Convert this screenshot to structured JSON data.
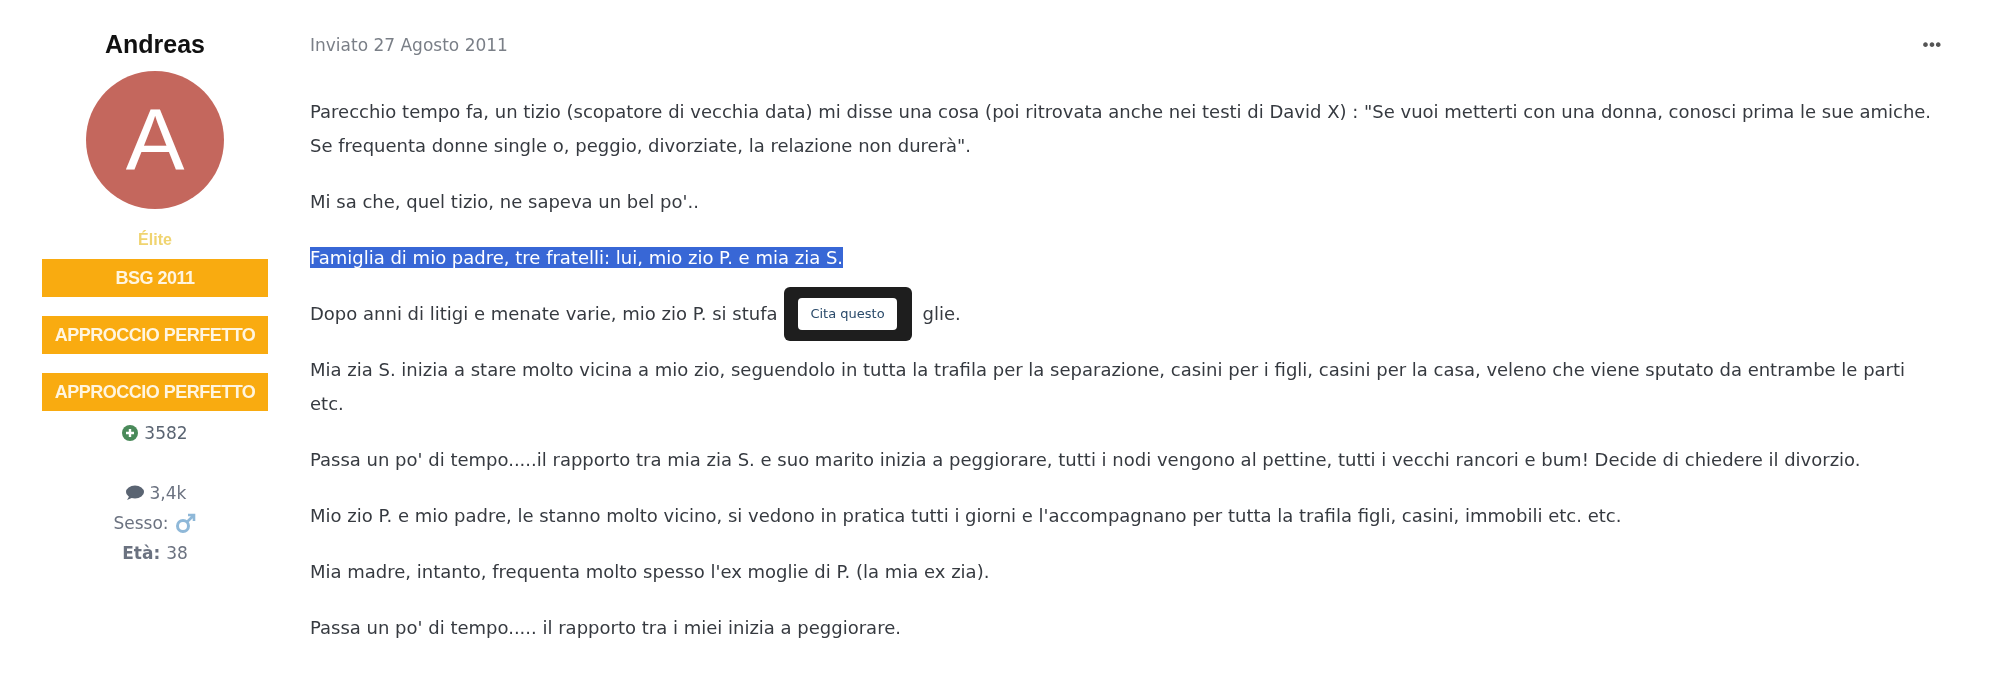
{
  "author": {
    "name": "Andreas",
    "avatar_letter": "A",
    "rank": "Élite",
    "badges": [
      "BSG 2011",
      "APPROCCIO PERFETTO",
      "APPROCCIO PERFETTO"
    ],
    "reputation": "3582",
    "posts": "3,4k",
    "gender_label": "Sesso:",
    "age_label": "Età:",
    "age": "38"
  },
  "post": {
    "date": "Inviato 27 Agosto 2011",
    "menu": "•••",
    "paragraphs": [
      {
        "text": "Parecchio tempo fa, un tizio (scopatore di vecchia data) mi disse una cosa (poi ritrovata anche nei testi di David X) : \"Se vuoi metterti con una donna, conosci prima le sue amiche. Se frequenta donne single o, peggio, divorziate, la relazione non durerà\".",
        "selected": false
      },
      {
        "text": "Mi sa che, quel tizio, ne sapeva un bel po'..",
        "selected": false
      },
      {
        "text": "Famiglia di mio padre, tre fratelli: lui, mio zio P. e mia zia S.",
        "selected": true
      },
      {
        "text": "Dopo anni di litigi e menate varie, mio zio P. si stufa",
        "after": "glie.",
        "tooltip": "Cita questo",
        "selected": false
      },
      {
        "text": "Mia zia S. inizia a stare molto vicina a mio zio, seguendolo in tutta la trafila per la separazione, casini per i figli, casini per la casa, veleno che viene sputato da entrambe le parti etc.",
        "selected": false
      },
      {
        "text": "Passa un po' di tempo.....il rapporto tra mia zia S. e suo marito inizia a peggiorare, tutti i nodi vengono al pettine, tutti i vecchi rancori e bum! Decide di chiedere il divorzio.",
        "selected": false
      },
      {
        "text": "Mio zio P. e mio padre, le stanno molto vicino, si vedono in pratica tutti i giorni e l'accompagnano per tutta la trafila figli, casini, immobili etc. etc.",
        "selected": false
      },
      {
        "text": "Mia madre, intanto, frequenta molto spesso l'ex moglie di P. (la mia ex zia).",
        "selected": false
      },
      {
        "text": "Passa un po' di tempo..... il rapporto tra i miei inizia a peggiorare.",
        "selected": false
      }
    ]
  }
}
